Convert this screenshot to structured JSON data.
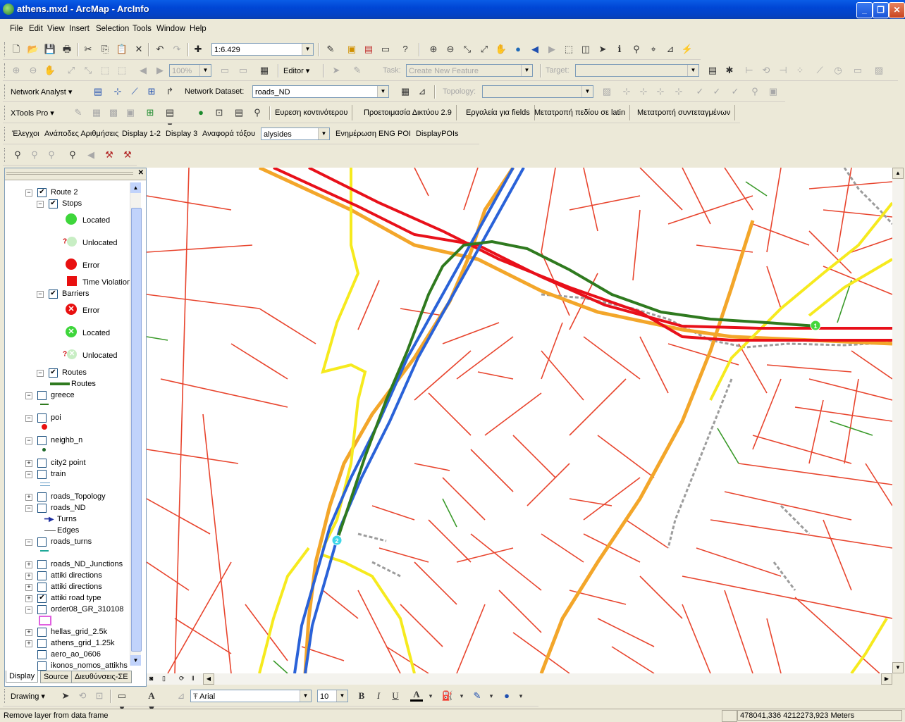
{
  "window": {
    "title": "athens.mxd - ArcMap - ArcInfo"
  },
  "menu": [
    "File",
    "Edit",
    "View",
    "Insert",
    "Selection",
    "Tools",
    "Window",
    "Help"
  ],
  "standard": {
    "scale": "1:6.429"
  },
  "editor": {
    "zoom": "100%",
    "editor_label": "Editor",
    "task_label": "Task:",
    "task_value": "Create New Feature",
    "target_label": "Target:"
  },
  "network_analyst": {
    "label": "Network Analyst",
    "dataset_label": "Network Dataset:",
    "dataset_value": "roads_ND",
    "topology_label": "Topology:"
  },
  "xtools": {
    "label": "XTools Pro",
    "buttons": [
      "Ευρεση κοντινότερου",
      "Προετοιμασία Δικτύου 2.9",
      "Εργαλεία για fields",
      "Μετατροπή πεδίου σε latin",
      "Μετατροπή συντεταγμένων"
    ]
  },
  "custom": {
    "items": [
      "Έλεγχοι",
      "Ανάποδες Αριθμήσεις",
      "Display 1-2",
      "Display 3",
      "Αναφορά τόξου"
    ],
    "combo": "alysides",
    "items2": [
      "Ενημέρωση ENG",
      "POI",
      "DisplayPOIs"
    ]
  },
  "toc": {
    "layers": [
      {
        "label": "Route 2",
        "checked": true,
        "expanded": true
      },
      {
        "label": "Stops",
        "checked": true,
        "expanded": true
      },
      {
        "label": "Located"
      },
      {
        "label": "Unlocated"
      },
      {
        "label": "Error"
      },
      {
        "label": "Time Violation"
      },
      {
        "label": "Barriers",
        "checked": true,
        "expanded": true
      },
      {
        "label": "Error"
      },
      {
        "label": "Located"
      },
      {
        "label": "Unlocated"
      },
      {
        "label": "Routes",
        "checked": true
      },
      {
        "label": "Routes"
      },
      {
        "label": "greece"
      },
      {
        "label": "poi"
      },
      {
        "label": "neighb_n"
      },
      {
        "label": "city2 point"
      },
      {
        "label": "train"
      },
      {
        "label": "roads_Topology"
      },
      {
        "label": "roads_ND"
      },
      {
        "label": "Turns"
      },
      {
        "label": "Edges"
      },
      {
        "label": "roads_turns"
      },
      {
        "label": "roads_ND_Junctions"
      },
      {
        "label": "attiki directions"
      },
      {
        "label": "attiki directions"
      },
      {
        "label": "attiki road type"
      },
      {
        "label": "order08_GR_310108"
      },
      {
        "label": "hellas_grid_2.5k"
      },
      {
        "label": "athens_grid_1.25k"
      },
      {
        "label": "aero_ao_0606"
      },
      {
        "label": "ikonos_nomos_attikhs"
      }
    ],
    "tabs": [
      "Display",
      "Source",
      "Διευθύνσεις-ΣΕ"
    ]
  },
  "map": {
    "stop1": "1",
    "stop2": "2"
  },
  "drawing": {
    "label": "Drawing",
    "font": "Arial",
    "size": "10",
    "bold": "B",
    "italic": "I",
    "underline": "U",
    "fontcolor": "A"
  },
  "status": {
    "message": "Remove layer from data frame",
    "coords": "478041,336  4212273,923 Meters"
  }
}
